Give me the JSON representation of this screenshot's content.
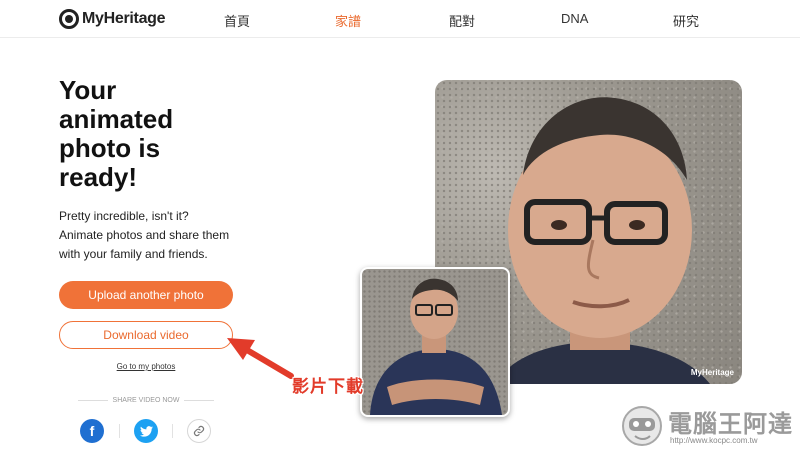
{
  "header": {
    "logo_text": "MyHeritage",
    "nav": [
      {
        "label": "首頁",
        "active": false
      },
      {
        "label": "家譜",
        "active": true
      },
      {
        "label": "配對",
        "active": false
      },
      {
        "label": "DNA",
        "active": false
      },
      {
        "label": "研究",
        "active": false
      }
    ]
  },
  "main": {
    "headline_lines": [
      "Your",
      "animated",
      "photo is",
      "ready!"
    ],
    "subtitle_lines": [
      "Pretty incredible, isn't it?",
      "Animate photos and share them",
      "with your family and friends."
    ],
    "upload_button": "Upload another photo",
    "download_button": "Download video",
    "photos_link": "Go to my photos",
    "share_label": "SHARE VIDEO NOW",
    "share_buttons": [
      {
        "icon": "facebook-icon",
        "glyph": "f"
      },
      {
        "icon": "twitter-icon",
        "glyph": "🐦"
      },
      {
        "icon": "link-icon",
        "glyph": "🔗"
      }
    ]
  },
  "photos": {
    "main_watermark": "MyHeritage"
  },
  "annotation": {
    "label": "影片下載",
    "color": "#e23b2a"
  },
  "site_watermark": {
    "title": "電腦王阿達",
    "url": "http://www.kocpc.com.tw"
  },
  "colors": {
    "accent": "#f07238",
    "facebook": "#1f6fd1",
    "twitter": "#1da1f2"
  }
}
